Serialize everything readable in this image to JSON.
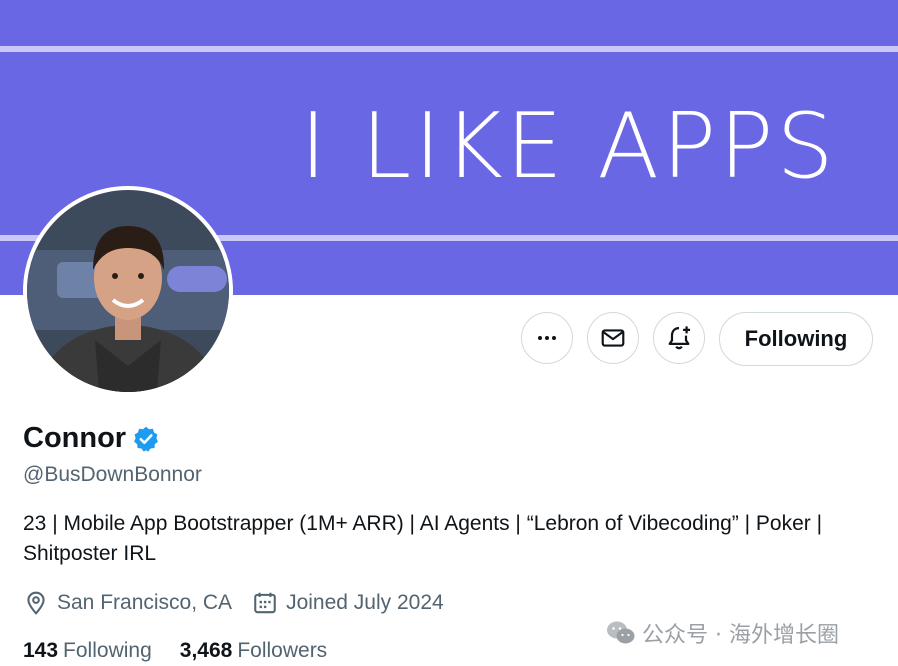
{
  "banner": {
    "text": "I LIKE APPS",
    "background": "#6a67e4"
  },
  "actions": {
    "more_icon": "more-horizontal-icon",
    "message_icon": "envelope-icon",
    "notify_icon": "bell-plus-icon",
    "follow_label": "Following"
  },
  "profile": {
    "name": "Connor",
    "verified_icon": "verified-badge-icon",
    "verified_color": "#1d9bf0",
    "handle": "@BusDownBonnor",
    "bio": "23 | Mobile App Bootstrapper (1M+ ARR) | AI Agents | “Lebron of Vibecoding” | Poker | Shitposter IRL",
    "location": "San Francisco, CA",
    "joined": "Joined July 2024",
    "following_count": "143",
    "following_label": "Following",
    "followers_count": "3,468",
    "followers_label": "Followers"
  },
  "watermark": {
    "text": "公众号 · 海外增长圈"
  }
}
